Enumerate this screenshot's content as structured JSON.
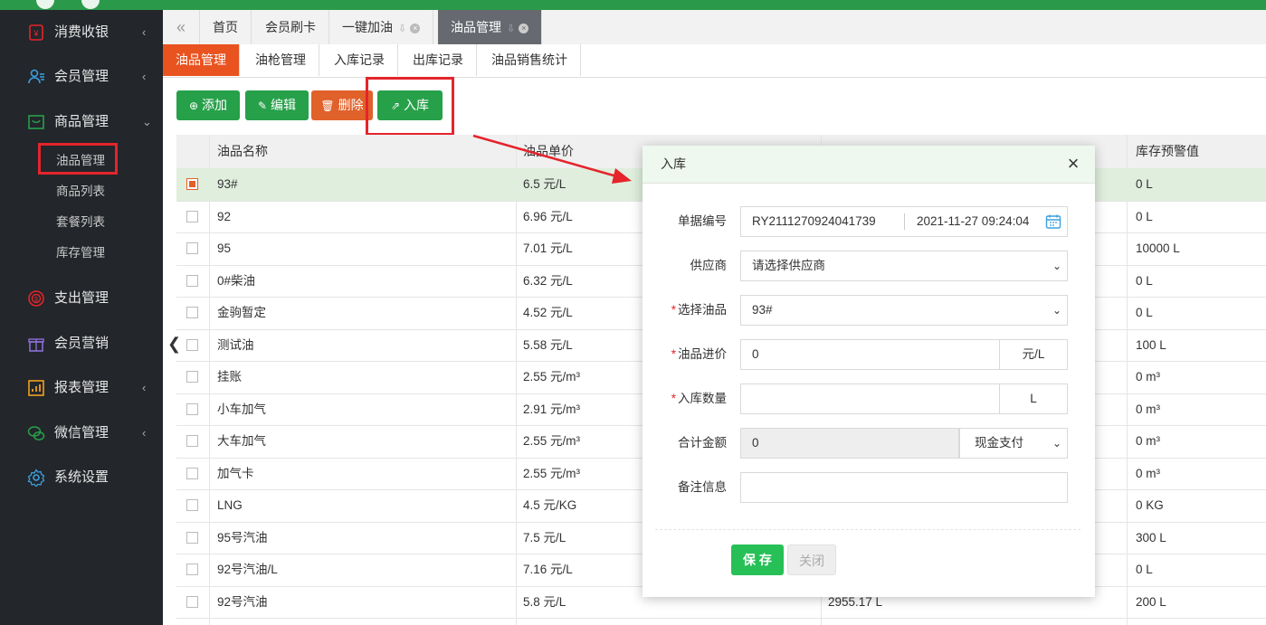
{
  "colors": {
    "brand_green": "#27a04a",
    "accent_orange": "#e9531f",
    "highlight_red": "#e5242b",
    "sidebar_bg": "#23262b"
  },
  "sidebar": {
    "items": [
      {
        "label": "消费收银",
        "icon": "cashier-icon",
        "arrow": "‹"
      },
      {
        "label": "会员管理",
        "icon": "members-icon",
        "arrow": "‹"
      },
      {
        "label": "商品管理",
        "icon": "goods-icon",
        "arrow": "⌄"
      },
      {
        "label": "支出管理",
        "icon": "expense-icon",
        "arrow": ""
      },
      {
        "label": "会员营销",
        "icon": "gift-icon",
        "arrow": ""
      },
      {
        "label": "报表管理",
        "icon": "report-icon",
        "arrow": "‹"
      },
      {
        "label": "微信管理",
        "icon": "wechat-icon",
        "arrow": "‹"
      },
      {
        "label": "系统设置",
        "icon": "gear-icon",
        "arrow": ""
      }
    ],
    "sub_items": [
      "油品管理",
      "商品列表",
      "套餐列表",
      "库存管理"
    ]
  },
  "tabs": [
    {
      "label": "首页"
    },
    {
      "label": "会员刷卡"
    },
    {
      "label": "一键加油"
    },
    {
      "label": "油品管理"
    }
  ],
  "subtabs": [
    "油品管理",
    "油枪管理",
    "入库记录",
    "出库记录",
    "油品销售统计"
  ],
  "toolbar": {
    "add": "添加",
    "edit": "编辑",
    "delete": "删除",
    "stock_in": "入库"
  },
  "table": {
    "headers": {
      "name": "油品名称",
      "price": "油品单价",
      "warning": "库存预警值"
    },
    "rows": [
      {
        "name": "93#",
        "price": "6.5 元/L",
        "stock": "",
        "warning": "0 L"
      },
      {
        "name": "92",
        "price": "6.96 元/L",
        "stock": "",
        "warning": "0 L"
      },
      {
        "name": "95",
        "price": "7.01 元/L",
        "stock": "",
        "warning": "10000 L"
      },
      {
        "name": "0#柴油",
        "price": "6.32 元/L",
        "stock": "",
        "warning": "0 L"
      },
      {
        "name": "金驹暂定",
        "price": "4.52 元/L",
        "stock": "",
        "warning": "0 L"
      },
      {
        "name": "测试油",
        "price": "5.58 元/L",
        "stock": "",
        "warning": "100 L"
      },
      {
        "name": "挂账",
        "price": "2.55 元/m³",
        "stock": "",
        "warning": "0 m³"
      },
      {
        "name": "小车加气",
        "price": "2.91 元/m³",
        "stock": "",
        "warning": "0 m³"
      },
      {
        "name": "大车加气",
        "price": "2.55 元/m³",
        "stock": "",
        "warning": "0 m³"
      },
      {
        "name": "加气卡",
        "price": "2.55 元/m³",
        "stock": "",
        "warning": "0 m³"
      },
      {
        "name": "LNG",
        "price": "4.5 元/KG",
        "stock": "",
        "warning": "0 KG"
      },
      {
        "name": "95号汽油",
        "price": "7.5 元/L",
        "stock": "",
        "warning": "300 L"
      },
      {
        "name": "92号汽油/L",
        "price": "7.16 元/L",
        "stock": "",
        "warning": "0 L"
      },
      {
        "name": "92号汽油",
        "price": "5.8 元/L",
        "stock": "2955.17 L",
        "warning": "200 L"
      }
    ]
  },
  "modal": {
    "title": "入库",
    "labels": {
      "doc_no": "单据编号",
      "supplier": "供应商",
      "oil": "选择油品",
      "cost": "油品进价",
      "qty": "入库数量",
      "total": "合计金额",
      "remark": "备注信息"
    },
    "doc_no": "RY2111270924041739",
    "date": "2021-11-27 09:24:04",
    "supplier_placeholder": "请选择供应商",
    "oil_selected": "93#",
    "cost_value": "0",
    "cost_unit": "元/L",
    "qty_value": "",
    "qty_unit": "L",
    "total_value": "0",
    "payment_selected": "现金支付",
    "remark_value": "",
    "save": "保 存",
    "close": "关闭"
  }
}
